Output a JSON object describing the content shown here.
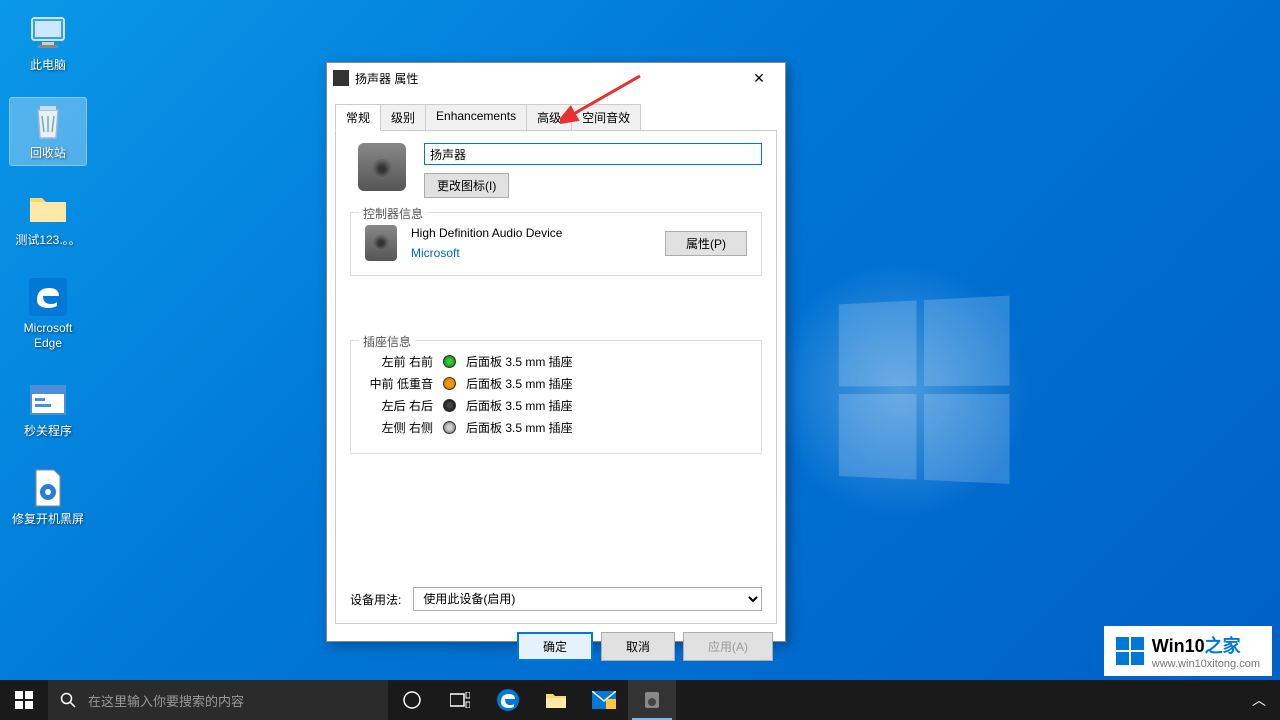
{
  "desktop": {
    "icons": [
      {
        "label": "此电脑",
        "name": "this-pc"
      },
      {
        "label": "回收站",
        "name": "recycle-bin",
        "selected": true
      },
      {
        "label": "测试123.。。",
        "name": "folder-test"
      },
      {
        "label": "Microsoft Edge",
        "name": "edge"
      },
      {
        "label": "秒关程序",
        "name": "quick-close"
      },
      {
        "label": "修复开机黑屏",
        "name": "fix-blackscreen"
      }
    ]
  },
  "dialog": {
    "title": "扬声器 属性",
    "tabs": [
      "常规",
      "级别",
      "Enhancements",
      "高级",
      "空间音效"
    ],
    "active_tab": 0,
    "name_value": "扬声器",
    "change_icon_btn": "更改图标(I)",
    "controller_group": "控制器信息",
    "controller_name": "High Definition Audio Device",
    "controller_vendor": "Microsoft",
    "properties_btn": "属性(P)",
    "jack_group": "插座信息",
    "jacks": [
      {
        "label": "左前 右前",
        "color": "green",
        "desc": "后面板 3.5 mm 插座"
      },
      {
        "label": "中前 低重音",
        "color": "orange",
        "desc": "后面板 3.5 mm 插座"
      },
      {
        "label": "左后 右后",
        "color": "black",
        "desc": "后面板 3.5 mm 插座"
      },
      {
        "label": "左侧 右侧",
        "color": "gray",
        "desc": "后面板 3.5 mm 插座"
      }
    ],
    "usage_label": "设备用法:",
    "usage_value": "使用此设备(启用)",
    "ok": "确定",
    "cancel": "取消",
    "apply": "应用(A)"
  },
  "taskbar": {
    "search_placeholder": "在这里输入你要搜索的内容"
  },
  "watermark": {
    "brand": "Win10",
    "brand_zh": "之家",
    "url": "www.win10xitong.com"
  }
}
